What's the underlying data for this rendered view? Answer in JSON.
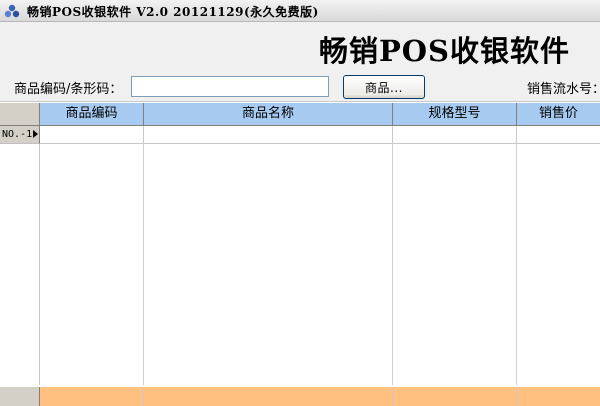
{
  "window": {
    "title": "畅销POS收银软件 V2.0 20121129(永久免费版)",
    "app_icon": "app-logo-icon"
  },
  "header": {
    "banner": "畅销POS收银软件"
  },
  "search": {
    "label": "商品编码/条形码：",
    "value": "",
    "placeholder": "",
    "button_label": "商品...",
    "serial_label": "销售流水号："
  },
  "grid": {
    "columns": [
      {
        "label": "商品编码"
      },
      {
        "label": "商品名称"
      },
      {
        "label": "规格型号"
      },
      {
        "label": "销售价"
      }
    ],
    "rows": [
      {
        "label": "NO.-1",
        "selected": true,
        "cells": [
          "",
          "",
          "",
          ""
        ]
      }
    ]
  },
  "colors": {
    "header_bg": "#a6caf0",
    "footer_bg": "#ffc080",
    "toolbar_bg": "#f0f0f0"
  }
}
